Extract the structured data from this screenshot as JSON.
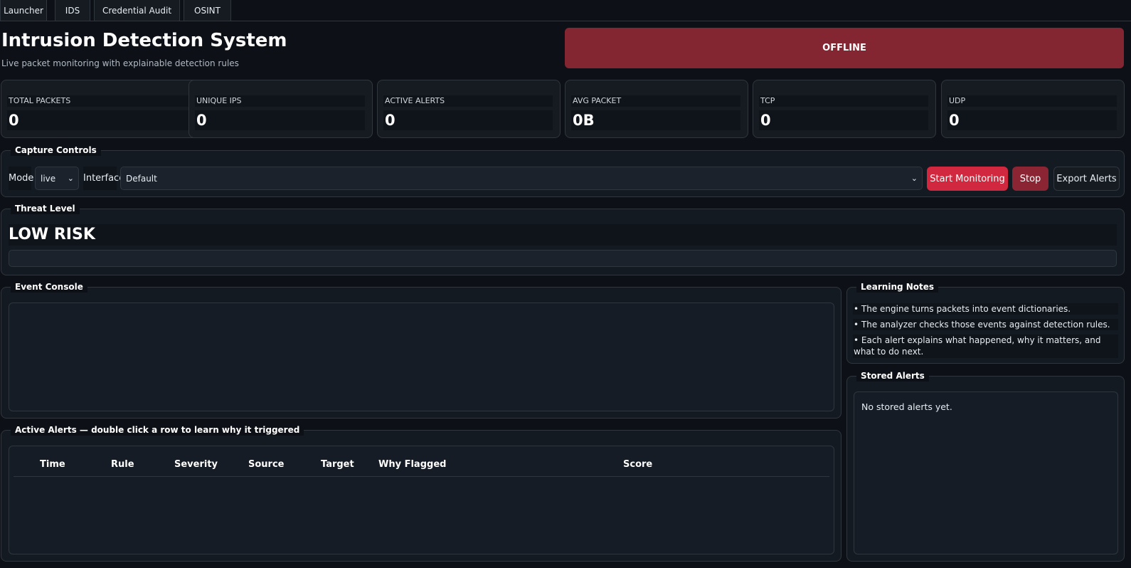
{
  "tabs": [
    {
      "label": "Launcher"
    },
    {
      "label": "IDS"
    },
    {
      "label": "Credential Audit"
    },
    {
      "label": "OSINT"
    }
  ],
  "header": {
    "title": "Intrusion Detection System",
    "subtitle": "Live packet monitoring with explainable detection rules",
    "status": "OFFLINE",
    "status_color": "#842632"
  },
  "stats": [
    {
      "label": "TOTAL PACKETS",
      "value": "0"
    },
    {
      "label": "UNIQUE IPS",
      "value": "0"
    },
    {
      "label": "ACTIVE ALERTS",
      "value": "0"
    },
    {
      "label": "AVG PACKET",
      "value": "0B"
    },
    {
      "label": "TCP",
      "value": "0"
    },
    {
      "label": "UDP",
      "value": "0"
    }
  ],
  "capture": {
    "legend": "Capture Controls",
    "mode_label": "Mode",
    "mode_value": "live",
    "interface_label": "Interface",
    "interface_value": "Default",
    "start_label": "Start Monitoring",
    "stop_label": "Stop",
    "export_label": "Export Alerts",
    "accent_color": "#d1283f"
  },
  "threat": {
    "legend": "Threat Level",
    "level_text": "LOW RISK",
    "level_fraction": 0
  },
  "console": {
    "legend": "Event Console"
  },
  "alerts": {
    "legend": "Active Alerts — double click a row to learn why it triggered",
    "columns": [
      "Time",
      "Rule",
      "Severity",
      "Source",
      "Target",
      "Why Flagged",
      "Score"
    ]
  },
  "notes": {
    "legend": "Learning Notes",
    "items": [
      "• The engine turns packets into event dictionaries.",
      "• The analyzer checks those events against detection rules.",
      "• Each alert explains what happened, why it matters, and what to do next."
    ]
  },
  "stored": {
    "legend": "Stored Alerts",
    "empty_text": "No stored alerts yet."
  }
}
